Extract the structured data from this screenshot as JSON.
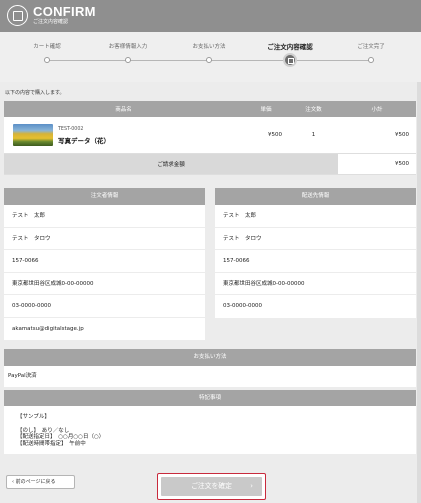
{
  "header": {
    "title": "CONFIRM",
    "subtitle": "ご注文内容確認"
  },
  "steps": [
    {
      "label": "カート確認",
      "active": false
    },
    {
      "label": "お客様情報入力",
      "active": false
    },
    {
      "label": "お支払い方法",
      "active": false
    },
    {
      "label": "ご注文内容確認",
      "active": true
    },
    {
      "label": "ご注文完了",
      "active": false
    }
  ],
  "intro": "以下の内容で購入します。",
  "items_table": {
    "headers": {
      "name": "商品名",
      "price": "単価",
      "qty": "注文数",
      "subtotal": "小計"
    },
    "rows": [
      {
        "code": "TEST-0002",
        "name": "写真データ（花）",
        "price": "¥500",
        "qty": "1",
        "subtotal": "¥500"
      }
    ],
    "total_label": "ご請求金額",
    "total_value": "¥500"
  },
  "orderer": {
    "title": "注文者情報",
    "lines": [
      "テスト　太郎",
      "テスト　タロウ",
      "157-0066",
      "東京都世田谷区成城0-00-00000",
      "03-0000-0000",
      "akamatsu@digitalstage.jp"
    ]
  },
  "shipping": {
    "title": "配送先情報",
    "lines": [
      "テスト　太郎",
      "テスト　タロウ",
      "157-0066",
      "東京都世田谷区成城0-00-00000",
      "03-0000-0000"
    ]
  },
  "payment": {
    "title": "お支払い方法",
    "value": "PayPal決済"
  },
  "notes": {
    "title": "特記事項",
    "body": "【サンプル】\n\n【のし】　あり／なし\n【配送指定日】　○○月○○日（○）\n【配送時間帯指定】　午前中"
  },
  "buttons": {
    "back": "前のページに戻る",
    "confirm": "ご注文を確定"
  },
  "icons": {
    "back": "chevron-left-icon",
    "confirm": "chevron-right-icon"
  },
  "colors": {
    "header_bg": "#8f8f8f",
    "table_head_bg": "#a4a4a4",
    "confirm_border": "#c82a3c"
  }
}
